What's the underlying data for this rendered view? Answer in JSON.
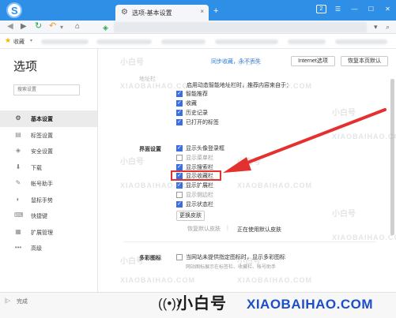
{
  "browser": {
    "tab_title": "选项-基本设置",
    "tab_close": "×",
    "new_tab": "+",
    "window_badge": "2",
    "window_controls": [
      "☰",
      "—",
      "☐",
      "✕"
    ]
  },
  "toolbar": {
    "icons": [
      "back-icon",
      "forward-icon",
      "refresh-icon",
      "undo-icon",
      "home-icon",
      "shield-icon"
    ]
  },
  "bookmarks": {
    "label": "收藏",
    "caret": "▾"
  },
  "sidebar": {
    "title": "选项",
    "search_placeholder": "搜索设置",
    "items": [
      {
        "label": "基本设置",
        "icon": "⚙",
        "icon_name": "gear-icon",
        "active": true
      },
      {
        "label": "标签设置",
        "icon": "▤",
        "icon_name": "tab-icon",
        "active": false
      },
      {
        "label": "安全设置",
        "icon": "◈",
        "icon_name": "shield-icon",
        "active": false
      },
      {
        "label": "下载",
        "icon": "⬇",
        "icon_name": "download-icon",
        "active": false
      },
      {
        "label": "帐号助手",
        "icon": "✎",
        "icon_name": "account-icon",
        "active": false
      },
      {
        "label": "鼠标手势",
        "icon": "◐",
        "icon_name": "mouse-icon",
        "active": false
      },
      {
        "label": "快捷键",
        "icon": "⌨",
        "icon_name": "keyboard-icon",
        "active": false
      },
      {
        "label": "扩展管理",
        "icon": "▦",
        "icon_name": "extension-icon",
        "active": false
      },
      {
        "label": "高级",
        "icon": "•••",
        "icon_name": "more-icon",
        "active": false
      }
    ]
  },
  "header": {
    "sync_link": "同步收藏，永不丢失",
    "internet_options_button": "Internet选项",
    "restore_defaults_button": "恢复本页默认"
  },
  "address_bar": {
    "section_label": "地址栏",
    "description": "启用动态智能地址栏时，推荐内容来自于：",
    "options": [
      {
        "label": "智能推荐",
        "checked": true
      },
      {
        "label": "收藏",
        "checked": true
      },
      {
        "label": "历史记录",
        "checked": true
      },
      {
        "label": "已打开的标签",
        "checked": true
      }
    ]
  },
  "interface": {
    "section_label": "界面设置",
    "options": [
      {
        "label": "显示头像登录框",
        "checked": true
      },
      {
        "label": "显示菜单栏",
        "checked": false
      },
      {
        "label": "显示搜索栏",
        "checked": true
      },
      {
        "label": "显示收藏栏",
        "checked": true,
        "highlighted": true
      },
      {
        "label": "显示扩展栏",
        "checked": true
      },
      {
        "label": "显示侧边栏",
        "checked": false
      },
      {
        "label": "显示状态栏",
        "checked": true
      }
    ],
    "change_skin_button": "更换皮肤",
    "restore_skin_button": "恢复默认皮肤",
    "current_skin_text": "正在使用默认皮肤"
  },
  "multicolor_icon": {
    "section_label": "多彩图标",
    "option_label": "当网站未提供指定图标时，显示多彩图标",
    "checked": false,
    "note": "网站图标展示在标签栏、收藏栏、帐号助手"
  },
  "status": {
    "text": "完成"
  },
  "watermark": {
    "brand_cn": "小白号",
    "brand_en": "XIAOBAIHAO.COM",
    "brand_icon": "((•))"
  },
  "annotation": {
    "highlight_color": "#e53030",
    "arrow_color": "#e53030"
  },
  "colors": {
    "titlebar": "#2f8fe6",
    "checkbox": "#3a6ee8",
    "link": "#2b7de0"
  }
}
